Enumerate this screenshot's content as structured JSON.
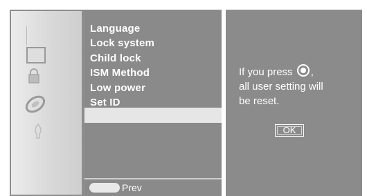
{
  "colors": {
    "panel_gray": "#8b8b8b",
    "highlight": "#e6e6e6",
    "text": "#ffffff",
    "border": "#ffffff"
  },
  "icons": [
    "tv-screen-icon",
    "lock-icon",
    "disc-icon",
    "bulb-icon",
    "ok-button-icon"
  ],
  "menu": {
    "items": [
      {
        "label": "Language"
      },
      {
        "label": "Lock system"
      },
      {
        "label": "Child lock"
      },
      {
        "label": "ISM Method"
      },
      {
        "label": "Low power"
      },
      {
        "label": "Set ID"
      }
    ],
    "prev_label": "Prev"
  },
  "dialog": {
    "line1_prefix": "If you press",
    "line1_suffix": ",",
    "line2": "all user setting will",
    "line3": "be reset.",
    "ok_label": "OK"
  }
}
